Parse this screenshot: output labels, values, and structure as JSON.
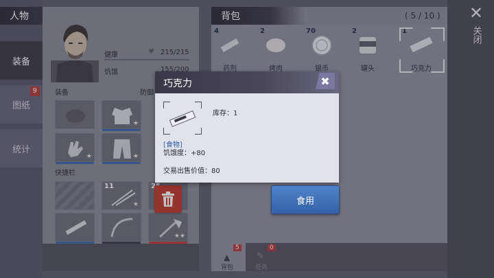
{
  "left_tabs": [
    {
      "label": "装备"
    },
    {
      "label": "图纸",
      "badge": "9"
    },
    {
      "label": "统计"
    }
  ],
  "character": {
    "header": "人物",
    "health_label": "健康",
    "health_value": "215/215",
    "hunger_label": "饥饿",
    "hunger_value": "155/200",
    "equipment_label": "装备",
    "defense_label": "防御",
    "quickbar_label": "快捷栏",
    "quick_counts": [
      "11",
      "25"
    ]
  },
  "backpack": {
    "header": "背包",
    "capacity": "( 5 / 10 )",
    "items": [
      {
        "name": "药剂",
        "count": "4"
      },
      {
        "name": "烤肉",
        "count": "2"
      },
      {
        "name": "银币",
        "count": "70"
      },
      {
        "name": "罐头",
        "count": "2"
      },
      {
        "name": "巧克力",
        "count": "1"
      }
    ],
    "bottom_tabs": [
      {
        "label": "背包",
        "badge": "5"
      },
      {
        "label": "任务",
        "badge": "0"
      }
    ]
  },
  "close_label": "关闭",
  "popup": {
    "title": "巧克力",
    "stock_text": "库存：1",
    "category": "[食物]",
    "effect": "饥饿度：+80",
    "sell_price": "交易出售价值：80",
    "action": "食用"
  },
  "colors": {
    "accent_blue": "#3f6fb2",
    "delete_red": "#c0392b",
    "panel_bg": "#8b8a99",
    "popup_bg": "#e2e2ea"
  }
}
